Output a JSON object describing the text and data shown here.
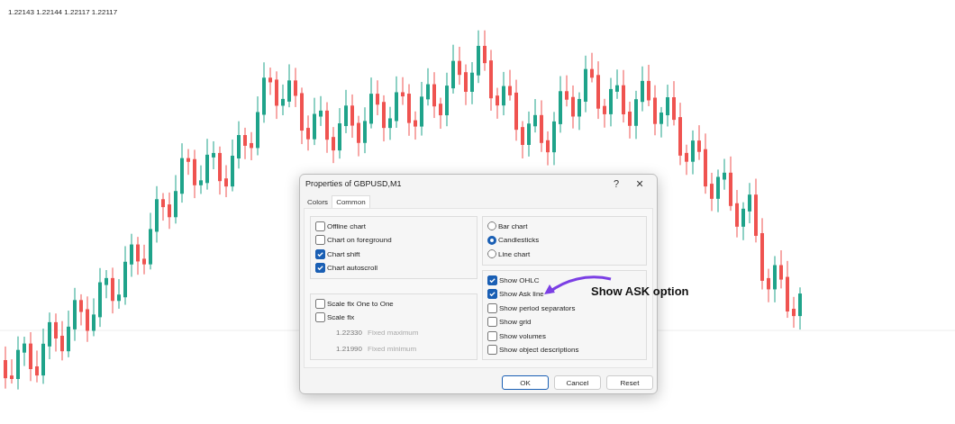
{
  "quote": "1.22143 1.22144 1.22117 1.22117",
  "dialog": {
    "title": "Properties of GBPUSD,M1",
    "help": "?",
    "close": "×",
    "tabs": [
      {
        "label": "Colors",
        "selected": false
      },
      {
        "label": "Common",
        "selected": true
      }
    ],
    "chart_options": [
      {
        "label": "Offline chart",
        "checked": false
      },
      {
        "label": "Chart on foreground",
        "checked": false
      },
      {
        "label": "Chart shift",
        "checked": true
      },
      {
        "label": "Chart autoscroll",
        "checked": true
      }
    ],
    "scale_options": [
      {
        "label": "Scale fix One to One",
        "checked": false
      },
      {
        "label": "Scale fix",
        "checked": false
      }
    ],
    "scale_fields": [
      {
        "value": "1.22330",
        "label": "Fixed maximum",
        "disabled": true
      },
      {
        "value": "1.21990",
        "label": "Fixed minimum",
        "disabled": true
      }
    ],
    "chart_types": [
      {
        "label": "Bar chart",
        "selected": false
      },
      {
        "label": "Candlesticks",
        "selected": true
      },
      {
        "label": "Line chart",
        "selected": false
      }
    ],
    "show_options": [
      {
        "label": "Show OHLC",
        "checked": true
      },
      {
        "label": "Show Ask line",
        "checked": true
      },
      {
        "label": "Show period separators",
        "checked": false
      },
      {
        "label": "Show grid",
        "checked": false
      },
      {
        "label": "Show volumes",
        "checked": false
      },
      {
        "label": "Show object descriptions",
        "checked": false
      }
    ],
    "buttons": [
      {
        "label": "OK",
        "default": true
      },
      {
        "label": "Cancel",
        "default": false
      },
      {
        "label": "Reset",
        "default": false
      }
    ]
  },
  "annotation": {
    "text": "Show ASK option"
  }
}
